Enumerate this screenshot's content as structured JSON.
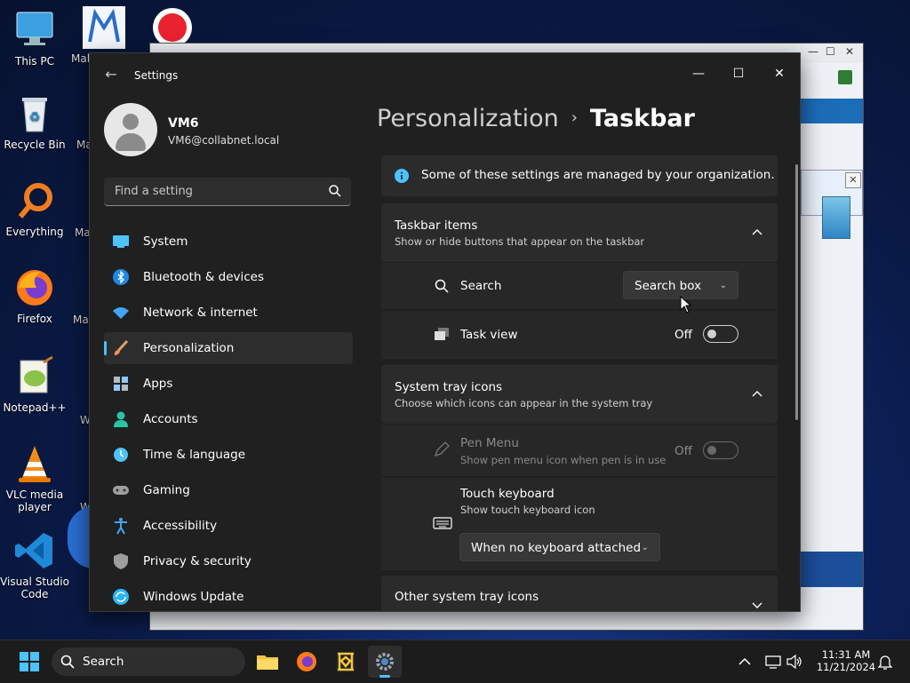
{
  "desktop": {
    "icons": [
      {
        "label": "This PC"
      },
      {
        "label": "Recycle Bin"
      },
      {
        "label": "Everything"
      },
      {
        "label": "Firefox"
      },
      {
        "label": "Notepad++"
      },
      {
        "label": "VLC media player"
      },
      {
        "label": "Visual Studio Code"
      }
    ],
    "peek_labels": [
      "Mal",
      "Ma",
      "Ma",
      "Ma",
      "W",
      "W",
      "W"
    ]
  },
  "settings": {
    "window_title": "Settings",
    "user": {
      "name": "VM6",
      "email": "VM6@collabnet.local"
    },
    "search_placeholder": "Find a setting",
    "nav": [
      {
        "label": "System",
        "icon": "monitor-icon"
      },
      {
        "label": "Bluetooth & devices",
        "icon": "bluetooth-icon"
      },
      {
        "label": "Network & internet",
        "icon": "wifi-icon"
      },
      {
        "label": "Personalization",
        "icon": "brush-icon",
        "active": true
      },
      {
        "label": "Apps",
        "icon": "apps-icon"
      },
      {
        "label": "Accounts",
        "icon": "person-icon"
      },
      {
        "label": "Time & language",
        "icon": "clock-globe-icon"
      },
      {
        "label": "Gaming",
        "icon": "gamepad-icon"
      },
      {
        "label": "Accessibility",
        "icon": "accessibility-icon"
      },
      {
        "label": "Privacy & security",
        "icon": "shield-icon"
      },
      {
        "label": "Windows Update",
        "icon": "update-icon"
      }
    ],
    "breadcrumb": {
      "parent": "Personalization",
      "separator": "›",
      "current": "Taskbar"
    },
    "info_banner": "Some of these settings are managed by your organization.",
    "taskbar_items": {
      "title": "Taskbar items",
      "subtitle": "Show or hide buttons that appear on the taskbar",
      "search": {
        "label": "Search",
        "value": "Search box"
      },
      "task_view": {
        "label": "Task view",
        "state": "Off"
      }
    },
    "system_tray": {
      "title": "System tray icons",
      "subtitle": "Choose which icons can appear in the system tray",
      "pen_menu": {
        "label": "Pen Menu",
        "sub": "Show pen menu icon when pen is in use",
        "state": "Off"
      },
      "touch_keyboard": {
        "label": "Touch keyboard",
        "sub": "Show touch keyboard icon",
        "value": "When no keyboard attached"
      }
    },
    "other_tray": {
      "title": "Other system tray icons"
    }
  },
  "taskbar": {
    "search_label": "Search",
    "time": "11:31 AM",
    "date": "11/21/2024"
  },
  "colors": {
    "accent": "#4cc2ff",
    "window_bg": "#202020",
    "card_bg": "#2b2b2b"
  }
}
